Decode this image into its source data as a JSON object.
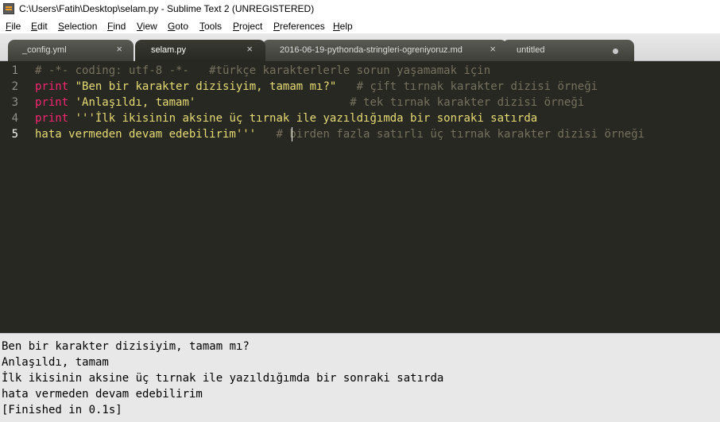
{
  "window": {
    "title": "C:\\Users\\Fatih\\Desktop\\selam.py - Sublime Text 2 (UNREGISTERED)"
  },
  "menu": [
    "File",
    "Edit",
    "Selection",
    "Find",
    "View",
    "Goto",
    "Tools",
    "Project",
    "Preferences",
    "Help"
  ],
  "tabs": [
    {
      "label": "_config.yml",
      "active": false,
      "close": "×"
    },
    {
      "label": "selam.py",
      "active": true,
      "close": "×"
    },
    {
      "label": "2016-06-19-pythonda-stringleri-ogreniyoruz.md",
      "active": false,
      "close": "×"
    },
    {
      "label": "untitled",
      "active": false,
      "dirty": true
    }
  ],
  "editor": {
    "line_numbers": [
      "1",
      "2",
      "3",
      "4",
      "5"
    ],
    "current_line": 5,
    "lines": [
      [
        {
          "t": "# -*- coding: utf-8 -*-   #türkçe karakterlerle sorun yaşamamak için",
          "c": "cmt"
        }
      ],
      [
        {
          "t": "print",
          "c": "kw"
        },
        {
          "t": " ",
          "c": ""
        },
        {
          "t": "\"Ben bir karakter dizisiyim, tamam mı?\"",
          "c": "str"
        },
        {
          "t": "   ",
          "c": ""
        },
        {
          "t": "# çift tırnak karakter dizisi örneği",
          "c": "cmt"
        }
      ],
      [
        {
          "t": "print",
          "c": "kw"
        },
        {
          "t": " ",
          "c": ""
        },
        {
          "t": "'Anlaşıldı, tamam'",
          "c": "str"
        },
        {
          "t": "                       ",
          "c": ""
        },
        {
          "t": "# tek tırnak karakter dizisi örneği",
          "c": "cmt"
        }
      ],
      [
        {
          "t": "print",
          "c": "kw"
        },
        {
          "t": " ",
          "c": ""
        },
        {
          "t": "'''İlk ikisinin aksine üç tırnak ile yazıldığımda bir sonraki satırda",
          "c": "str"
        }
      ],
      [
        {
          "t": "hata vermeden devam edebilirim'''",
          "c": "str"
        },
        {
          "t": "   ",
          "c": ""
        },
        {
          "t": "# birden fazla satırlı üç tırnak karakter dizisi örneği",
          "c": "cmt"
        }
      ]
    ]
  },
  "output": {
    "lines": [
      "Ben bir karakter dizisiyim, tamam mı?",
      "Anlaşıldı, tamam",
      "İlk ikisinin aksine üç tırnak ile yazıldığımda bir sonraki satırda",
      "hata vermeden devam edebilirim",
      "[Finished in 0.1s]"
    ]
  },
  "colors": {
    "editor_bg": "#272822",
    "keyword": "#f92672",
    "string": "#e6db74",
    "comment": "#75715e",
    "output_bg": "#e8e8e8"
  }
}
